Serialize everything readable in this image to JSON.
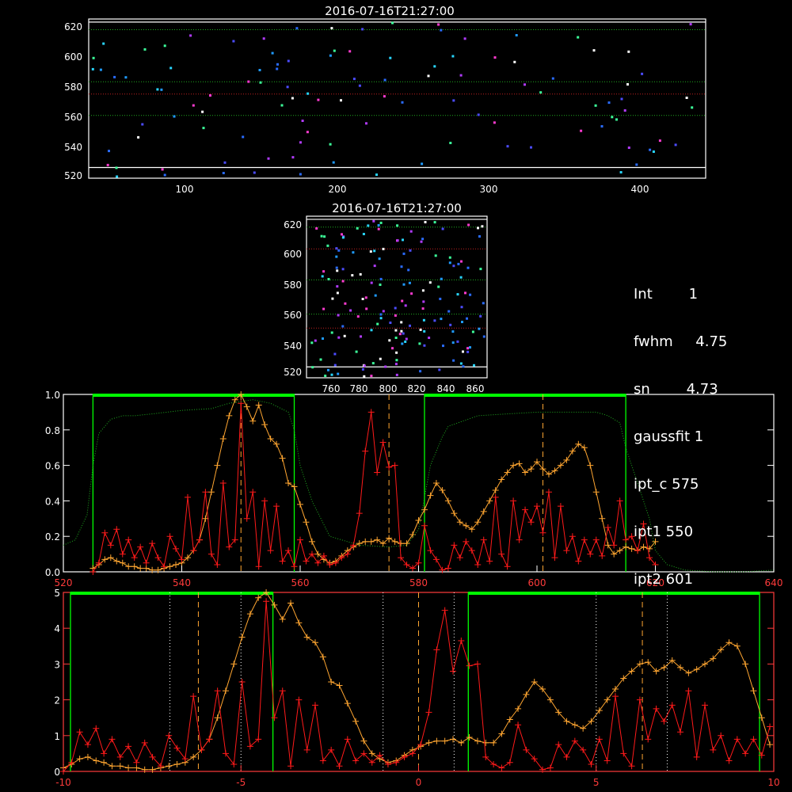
{
  "top_panel": {
    "title": "2016-07-16T21:27:00",
    "xticks": [
      "100",
      "200",
      "300",
      "400"
    ],
    "yticks": [
      "520",
      "540",
      "560",
      "580",
      "600",
      "620"
    ]
  },
  "mid_panel": {
    "title": "2016-07-16T21:27:00",
    "xticks": [
      "760",
      "780",
      "800",
      "820",
      "840",
      "860"
    ],
    "yticks": [
      "520",
      "540",
      "560",
      "580",
      "600",
      "620"
    ]
  },
  "info": [
    {
      "label": "Int",
      "value": "1"
    },
    {
      "label": "fwhm",
      "value": "4.75"
    },
    {
      "label": "sn",
      "value": "4.73"
    },
    {
      "label": "gaussfit",
      "value": "1"
    },
    {
      "label": "ipt_c",
      "value": "575"
    },
    {
      "label": "ipt1",
      "value": "550"
    },
    {
      "label": "ipt2",
      "value": "601"
    }
  ],
  "colors": {
    "green": "#00ff00",
    "orange": "#ffa631",
    "red": "#ff1a1a",
    "white": "#ffffff",
    "dotted_green": "#1faa1f"
  },
  "chart_data": [
    {
      "type": "scatter",
      "panel": "top",
      "title": "2016-07-16T21:27:00",
      "xlim": [
        35,
        445
      ],
      "ylim": [
        518,
        622
      ],
      "xticks": [
        100,
        200,
        300,
        400
      ],
      "yticks": [
        520,
        540,
        560,
        580,
        600,
        620
      ],
      "hlines_green_dotted": [
        615,
        581,
        559
      ],
      "hlines_red_dotted": [
        573
      ],
      "hlines_white": [
        620,
        525
      ]
    },
    {
      "type": "scatter",
      "panel": "middle",
      "title": "2016-07-16T21:27:00",
      "xlim": [
        743,
        866
      ],
      "ylim": [
        518,
        622
      ],
      "xticks": [
        760,
        780,
        800,
        820,
        840,
        860
      ],
      "yticks": [
        520,
        540,
        560,
        580,
        600,
        620
      ],
      "hlines_green_dotted": [
        615,
        581,
        559
      ],
      "hlines_red_dotted": [
        601,
        550
      ],
      "hlines_white": [
        620,
        525
      ]
    },
    {
      "type": "line",
      "panel": "spectrum-wavelength",
      "xlim": [
        520,
        640
      ],
      "ylim": [
        0,
        1.0
      ],
      "xticks": [
        520,
        540,
        560,
        580,
        600,
        620,
        640
      ],
      "yticks_left": [
        "0.0",
        "0.2",
        "0.4",
        "0.6",
        "0.8",
        "1.0"
      ],
      "vlines_dashed": [
        550,
        575,
        601
      ],
      "green_windows": [
        [
          525,
          559
        ],
        [
          581,
          615
        ]
      ],
      "series": [
        {
          "color": "orange",
          "x": [
            525,
            526,
            527,
            528,
            529,
            530,
            531,
            532,
            533,
            534,
            535,
            536,
            537,
            538,
            539,
            540,
            541,
            542,
            543,
            544,
            545,
            546,
            547,
            548,
            549,
            550,
            551,
            552,
            553,
            554,
            555,
            556,
            557,
            558,
            559,
            560,
            561,
            562,
            563,
            564,
            565,
            566,
            567,
            568,
            569,
            570,
            571,
            572,
            573,
            574,
            575,
            576,
            577,
            578,
            579,
            580,
            581,
            582,
            583,
            584,
            585,
            586,
            587,
            588,
            589,
            590,
            591,
            592,
            593,
            594,
            595,
            596,
            597,
            598,
            599,
            600,
            601,
            602,
            603,
            604,
            605,
            606,
            607,
            608,
            609,
            610,
            611,
            612,
            613,
            614,
            615,
            616,
            617,
            618,
            619,
            620
          ],
          "y": [
            0.02,
            0.04,
            0.07,
            0.08,
            0.06,
            0.05,
            0.03,
            0.03,
            0.02,
            0.02,
            0.01,
            0.01,
            0.02,
            0.03,
            0.04,
            0.05,
            0.08,
            0.12,
            0.18,
            0.3,
            0.45,
            0.6,
            0.75,
            0.88,
            0.97,
            1.0,
            0.93,
            0.85,
            0.94,
            0.83,
            0.75,
            0.72,
            0.64,
            0.5,
            0.48,
            0.38,
            0.28,
            0.17,
            0.1,
            0.07,
            0.05,
            0.06,
            0.09,
            0.12,
            0.14,
            0.16,
            0.17,
            0.17,
            0.18,
            0.16,
            0.19,
            0.17,
            0.16,
            0.16,
            0.21,
            0.29,
            0.35,
            0.43,
            0.5,
            0.46,
            0.4,
            0.33,
            0.28,
            0.26,
            0.24,
            0.28,
            0.34,
            0.4,
            0.46,
            0.52,
            0.56,
            0.6,
            0.61,
            0.56,
            0.58,
            0.62,
            0.58,
            0.55,
            0.57,
            0.6,
            0.63,
            0.68,
            0.72,
            0.7,
            0.6,
            0.45,
            0.3,
            0.15,
            0.1,
            0.12,
            0.14,
            0.13,
            0.12,
            0.14,
            0.13,
            0.17
          ]
        },
        {
          "color": "red",
          "x": [
            525,
            526,
            527,
            528,
            529,
            530,
            531,
            532,
            533,
            534,
            535,
            536,
            537,
            538,
            539,
            540,
            541,
            542,
            543,
            544,
            545,
            546,
            547,
            548,
            549,
            550,
            551,
            552,
            553,
            554,
            555,
            556,
            557,
            558,
            559,
            560,
            561,
            562,
            563,
            564,
            565,
            566,
            567,
            568,
            569,
            570,
            571,
            572,
            573,
            574,
            575,
            576,
            577,
            578,
            579,
            580,
            581,
            582,
            583,
            584,
            585,
            586,
            587,
            588,
            589,
            590,
            591,
            592,
            593,
            594,
            595,
            596,
            597,
            598,
            599,
            600,
            601,
            602,
            603,
            604,
            605,
            606,
            607,
            608,
            609,
            610,
            611,
            612,
            613,
            614,
            615,
            616,
            617,
            618,
            619,
            620
          ],
          "y": [
            0.0,
            0.05,
            0.22,
            0.15,
            0.24,
            0.1,
            0.18,
            0.08,
            0.14,
            0.05,
            0.16,
            0.08,
            0.03,
            0.2,
            0.13,
            0.07,
            0.42,
            0.12,
            0.18,
            0.45,
            0.1,
            0.04,
            0.5,
            0.14,
            0.18,
            0.95,
            0.3,
            0.45,
            0.03,
            0.4,
            0.12,
            0.37,
            0.06,
            0.12,
            0.03,
            0.18,
            0.06,
            0.1,
            0.05,
            0.09,
            0.04,
            0.05,
            0.08,
            0.1,
            0.15,
            0.33,
            0.68,
            0.9,
            0.56,
            0.73,
            0.59,
            0.6,
            0.08,
            0.04,
            0.02,
            0.05,
            0.26,
            0.12,
            0.07,
            0.01,
            0.02,
            0.15,
            0.08,
            0.17,
            0.12,
            0.04,
            0.18,
            0.06,
            0.42,
            0.1,
            0.03,
            0.4,
            0.18,
            0.35,
            0.28,
            0.37,
            0.22,
            0.45,
            0.08,
            0.37,
            0.12,
            0.2,
            0.06,
            0.18,
            0.1,
            0.18,
            0.09,
            0.25,
            0.15,
            0.4,
            0.18,
            0.2,
            0.12,
            0.27,
            0.08,
            0.04
          ]
        },
        {
          "color": "dotted_green",
          "x": [
            520,
            522,
            524,
            525,
            526,
            527,
            528,
            530,
            532,
            535,
            540,
            545,
            548,
            550,
            552,
            555,
            558,
            559,
            560,
            562,
            565,
            570,
            575,
            578,
            580,
            581,
            582,
            584,
            585,
            590,
            595,
            600,
            605,
            610,
            612,
            614,
            615,
            617,
            619,
            620,
            622,
            625,
            630,
            635,
            640
          ],
          "y": [
            0.15,
            0.18,
            0.32,
            0.6,
            0.78,
            0.82,
            0.86,
            0.88,
            0.88,
            0.89,
            0.91,
            0.92,
            0.95,
            0.96,
            0.97,
            0.95,
            0.9,
            0.8,
            0.6,
            0.4,
            0.2,
            0.15,
            0.14,
            0.15,
            0.24,
            0.42,
            0.6,
            0.76,
            0.82,
            0.88,
            0.89,
            0.9,
            0.9,
            0.9,
            0.88,
            0.84,
            0.7,
            0.5,
            0.3,
            0.12,
            0.04,
            0.01,
            0.0,
            0.0,
            0.01
          ]
        }
      ]
    },
    {
      "type": "line",
      "panel": "spectrum-velocity",
      "xlim": [
        -10,
        10
      ],
      "ylim": [
        0,
        5
      ],
      "xticks": [
        -10,
        -5,
        0,
        5,
        10
      ],
      "yticks_left": [
        "0",
        "1",
        "2",
        "3",
        "4",
        "5"
      ],
      "vlines_dashed": [
        -6.2,
        0,
        6.3
      ],
      "vlines_dotted": [
        -7.0,
        -5.0,
        -1.0,
        1.0,
        5.0,
        7.0
      ],
      "green_windows": [
        [
          -9.8,
          -4.1
        ],
        [
          1.4,
          9.6
        ]
      ],
      "series": [
        {
          "color": "orange",
          "x": [
            -10.0,
            -9.77,
            -9.54,
            -9.31,
            -9.08,
            -8.86,
            -8.63,
            -8.4,
            -8.17,
            -7.94,
            -7.71,
            -7.49,
            -7.26,
            -7.03,
            -6.8,
            -6.57,
            -6.34,
            -6.11,
            -5.89,
            -5.66,
            -5.43,
            -5.2,
            -4.97,
            -4.74,
            -4.51,
            -4.29,
            -4.06,
            -3.83,
            -3.6,
            -3.37,
            -3.14,
            -2.91,
            -2.69,
            -2.46,
            -2.23,
            -2.0,
            -1.77,
            -1.54,
            -1.31,
            -1.09,
            -0.86,
            -0.63,
            -0.4,
            -0.17,
            0.06,
            0.29,
            0.51,
            0.74,
            0.97,
            1.2,
            1.43,
            1.66,
            1.89,
            2.11,
            2.34,
            2.57,
            2.8,
            3.03,
            3.26,
            3.49,
            3.71,
            3.94,
            4.17,
            4.4,
            4.63,
            4.86,
            5.09,
            5.31,
            5.54,
            5.77,
            6.0,
            6.23,
            6.46,
            6.69,
            6.91,
            7.14,
            7.37,
            7.6,
            7.83,
            8.06,
            8.29,
            8.51,
            8.74,
            8.97,
            9.2,
            9.43,
            9.66,
            9.89
          ],
          "y": [
            0.1,
            0.2,
            0.35,
            0.4,
            0.3,
            0.25,
            0.15,
            0.15,
            0.1,
            0.1,
            0.05,
            0.05,
            0.1,
            0.15,
            0.2,
            0.25,
            0.4,
            0.6,
            0.9,
            1.5,
            2.25,
            3.0,
            3.75,
            4.4,
            4.85,
            5.0,
            4.65,
            4.25,
            4.7,
            4.15,
            3.75,
            3.6,
            3.2,
            2.5,
            2.4,
            1.9,
            1.4,
            0.85,
            0.5,
            0.35,
            0.25,
            0.3,
            0.45,
            0.6,
            0.7,
            0.8,
            0.85,
            0.85,
            0.9,
            0.8,
            0.95,
            0.85,
            0.8,
            0.8,
            1.05,
            1.45,
            1.75,
            2.15,
            2.5,
            2.3,
            2.0,
            1.65,
            1.4,
            1.3,
            1.2,
            1.4,
            1.7,
            2.0,
            2.3,
            2.6,
            2.8,
            3.0,
            3.05,
            2.8,
            2.9,
            3.1,
            2.9,
            2.75,
            2.85,
            3.0,
            3.15,
            3.4,
            3.6,
            3.5,
            3.0,
            2.25,
            1.5,
            0.75
          ]
        },
        {
          "color": "red",
          "x": [
            -10.0,
            -9.77,
            -9.54,
            -9.31,
            -9.08,
            -8.86,
            -8.63,
            -8.4,
            -8.17,
            -7.94,
            -7.71,
            -7.49,
            -7.26,
            -7.03,
            -6.8,
            -6.57,
            -6.34,
            -6.11,
            -5.89,
            -5.66,
            -5.43,
            -5.2,
            -4.97,
            -4.74,
            -4.51,
            -4.29,
            -4.06,
            -3.83,
            -3.6,
            -3.37,
            -3.14,
            -2.91,
            -2.69,
            -2.46,
            -2.23,
            -2.0,
            -1.77,
            -1.54,
            -1.31,
            -1.09,
            -0.86,
            -0.63,
            -0.4,
            -0.17,
            0.06,
            0.29,
            0.51,
            0.74,
            0.97,
            1.2,
            1.43,
            1.66,
            1.89,
            2.11,
            2.34,
            2.57,
            2.8,
            3.03,
            3.26,
            3.49,
            3.71,
            3.94,
            4.17,
            4.4,
            4.63,
            4.86,
            5.09,
            5.31,
            5.54,
            5.77,
            6.0,
            6.23,
            6.46,
            6.69,
            6.91,
            7.14,
            7.37,
            7.6,
            7.83,
            8.06,
            8.29,
            8.51,
            8.74,
            8.97,
            9.2,
            9.43,
            9.66,
            9.89
          ],
          "y": [
            0.0,
            0.25,
            1.1,
            0.75,
            1.2,
            0.5,
            0.9,
            0.4,
            0.7,
            0.25,
            0.8,
            0.4,
            0.15,
            1.0,
            0.65,
            0.35,
            2.1,
            0.6,
            0.9,
            2.25,
            0.5,
            0.2,
            2.5,
            0.7,
            0.9,
            4.75,
            1.5,
            2.25,
            0.15,
            2.0,
            0.6,
            1.85,
            0.3,
            0.6,
            0.15,
            0.9,
            0.3,
            0.5,
            0.25,
            0.45,
            0.2,
            0.25,
            0.4,
            0.5,
            0.75,
            1.65,
            3.4,
            4.5,
            2.8,
            3.65,
            2.95,
            3.0,
            0.4,
            0.2,
            0.1,
            0.25,
            1.3,
            0.6,
            0.35,
            0.05,
            0.1,
            0.75,
            0.4,
            0.85,
            0.6,
            0.2,
            0.9,
            0.3,
            2.1,
            0.5,
            0.15,
            2.0,
            0.9,
            1.75,
            1.4,
            1.85,
            1.1,
            2.25,
            0.4,
            1.85,
            0.6,
            1.0,
            0.3,
            0.9,
            0.5,
            0.9,
            0.45,
            1.25
          ]
        }
      ]
    }
  ]
}
